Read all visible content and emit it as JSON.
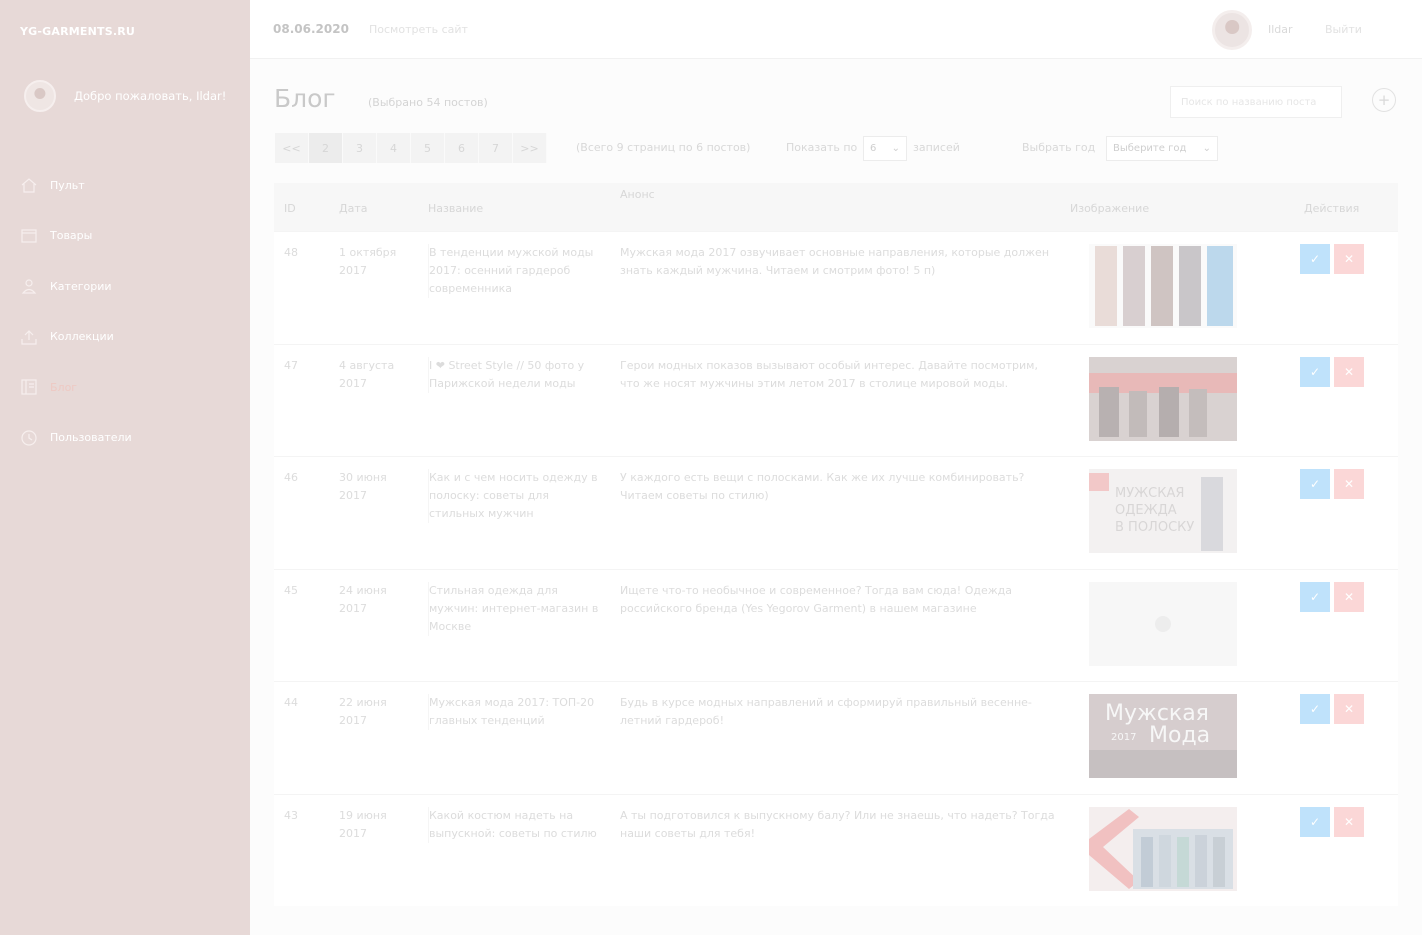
{
  "sidebar": {
    "brand": "YG-GARMENTS.RU",
    "welcome": "Добро пожаловать, Ildar!",
    "items": [
      {
        "label": "Пульт",
        "icon": "home-icon"
      },
      {
        "label": "Товары",
        "icon": "box-icon"
      },
      {
        "label": "Категории",
        "icon": "user-icon"
      },
      {
        "label": "Коллекции",
        "icon": "upload-icon"
      },
      {
        "label": "Блог",
        "icon": "book-icon",
        "active": true
      },
      {
        "label": "Пользователи",
        "icon": "clock-icon"
      }
    ]
  },
  "topbar": {
    "date": "08.06.2020",
    "site_link": "Посмотреть сайт",
    "user": "Ildar",
    "logout": "Выйти"
  },
  "header": {
    "title": "Блог",
    "count": "(Выбрано 54 постов)",
    "search_placeholder": "Поиск по названию поста"
  },
  "pager": {
    "prev": "<<",
    "pages": [
      "2",
      "3",
      "4",
      "5",
      "6",
      "7"
    ],
    "next": ">>",
    "current": "2",
    "info": "(Всего 9 страниц по 6 постов)",
    "show_by": "Показать по",
    "show_value": "6",
    "records": "записей",
    "year_label": "Выбрать год",
    "year_value": "Выберите год"
  },
  "table": {
    "columns": {
      "id": "ID",
      "date": "Дата",
      "title": "Название",
      "anons": "Анонс",
      "image": "Изображение",
      "actions": "Действия"
    },
    "rows": [
      {
        "id": "48",
        "date": "1 октября 2017",
        "title": "В тенденции мужской моды 2017: осенний гардероб современника",
        "anons": "Мужская мода 2017 озвучивает основные направления, которые должен знать каждый мужчина. Читаем и смотрим фото! 5 п)",
        "image": "fashion-group"
      },
      {
        "id": "47",
        "date": "4 августа 2017",
        "title": "I ❤ Street Style // 50 фото у Парижской недели моды",
        "anons": "Герои модных показов вызывают особый интерес. Давайте посмотрим, что же носят мужчины этим летом 2017 в столице мировой моды.",
        "image": "street-style"
      },
      {
        "id": "46",
        "date": "30 июня 2017",
        "title": "Как и с чем носить одежду в полоску: советы для стильных мужчин",
        "anons": "У каждого есть вещи с полосками. Как же их лучше комбинировать? Читаем советы по стилю)",
        "image": "stripes"
      },
      {
        "id": "45",
        "date": "24 июня 2017",
        "title": "Стильная одежда для мужчин: интернет-магазин в Москве",
        "anons": "Ищете что-то необычное и современное? Тогда вам сюда! Одежда российского бренда (Yes Yegorov Garment) в нашем магазине",
        "image": "placeholder"
      },
      {
        "id": "44",
        "date": "22 июня 2017",
        "title": "Мужская мода 2017: ТОП-20 главных тенденций",
        "anons": "Будь в курсе модных направлений и сформируй правильный весенне-летний гардероб!",
        "image": "mens-fashion"
      },
      {
        "id": "43",
        "date": "19 июня 2017",
        "title": "Какой костюм надеть на выпускной: советы по стилю",
        "anons": "А ты подготовился к выпускному балу? Или не знаешь, что надеть? Тогда наши советы для тебя!",
        "image": "graduation"
      }
    ]
  }
}
